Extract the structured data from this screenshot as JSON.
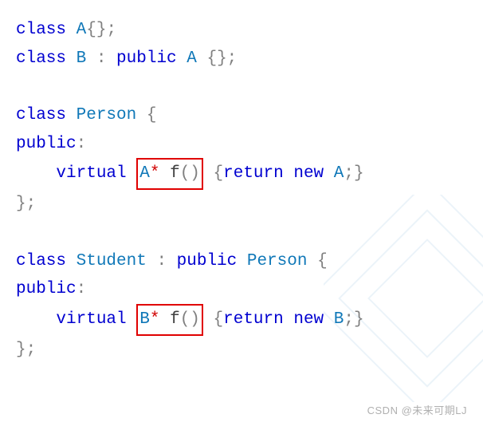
{
  "lines": {
    "l1": {
      "kw": "class",
      "type": " A",
      "punc": "{};"
    },
    "l2": {
      "kw": "class",
      "type": " B ",
      "colon": ":",
      "pub": " public",
      "base": " A ",
      "punc": "{};"
    },
    "l3": {
      "kw": "class",
      "type": " Person ",
      "brace": "{"
    },
    "l4": {
      "kw": "public",
      "colon": ":"
    },
    "l5": {
      "indent": "    ",
      "kw": "virtual ",
      "boxed_type": "A",
      "boxed_star": "* ",
      "boxed_fn": "f",
      "boxed_paren": "()",
      "space": " ",
      "brace_l": "{",
      "ret": "return ",
      "newk": "new",
      "obj": " A",
      "semi": ";",
      "brace_r": "}"
    },
    "l6": {
      "punc": "};"
    },
    "l7": {
      "kw": "class",
      "type": " Student ",
      "colon": ":",
      "pub": " public",
      "base": " Person ",
      "brace": "{"
    },
    "l8": {
      "kw": "public",
      "colon": ":"
    },
    "l9": {
      "indent": "    ",
      "kw": "virtual ",
      "boxed_type": "B",
      "boxed_star": "* ",
      "boxed_fn": "f",
      "boxed_paren": "()",
      "space": " ",
      "brace_l": "{",
      "ret": "return ",
      "newk": "new",
      "obj": " B",
      "semi": ";",
      "brace_r": "}"
    },
    "l10": {
      "punc": "};"
    }
  },
  "watermark": "CSDN @未来可期LJ"
}
